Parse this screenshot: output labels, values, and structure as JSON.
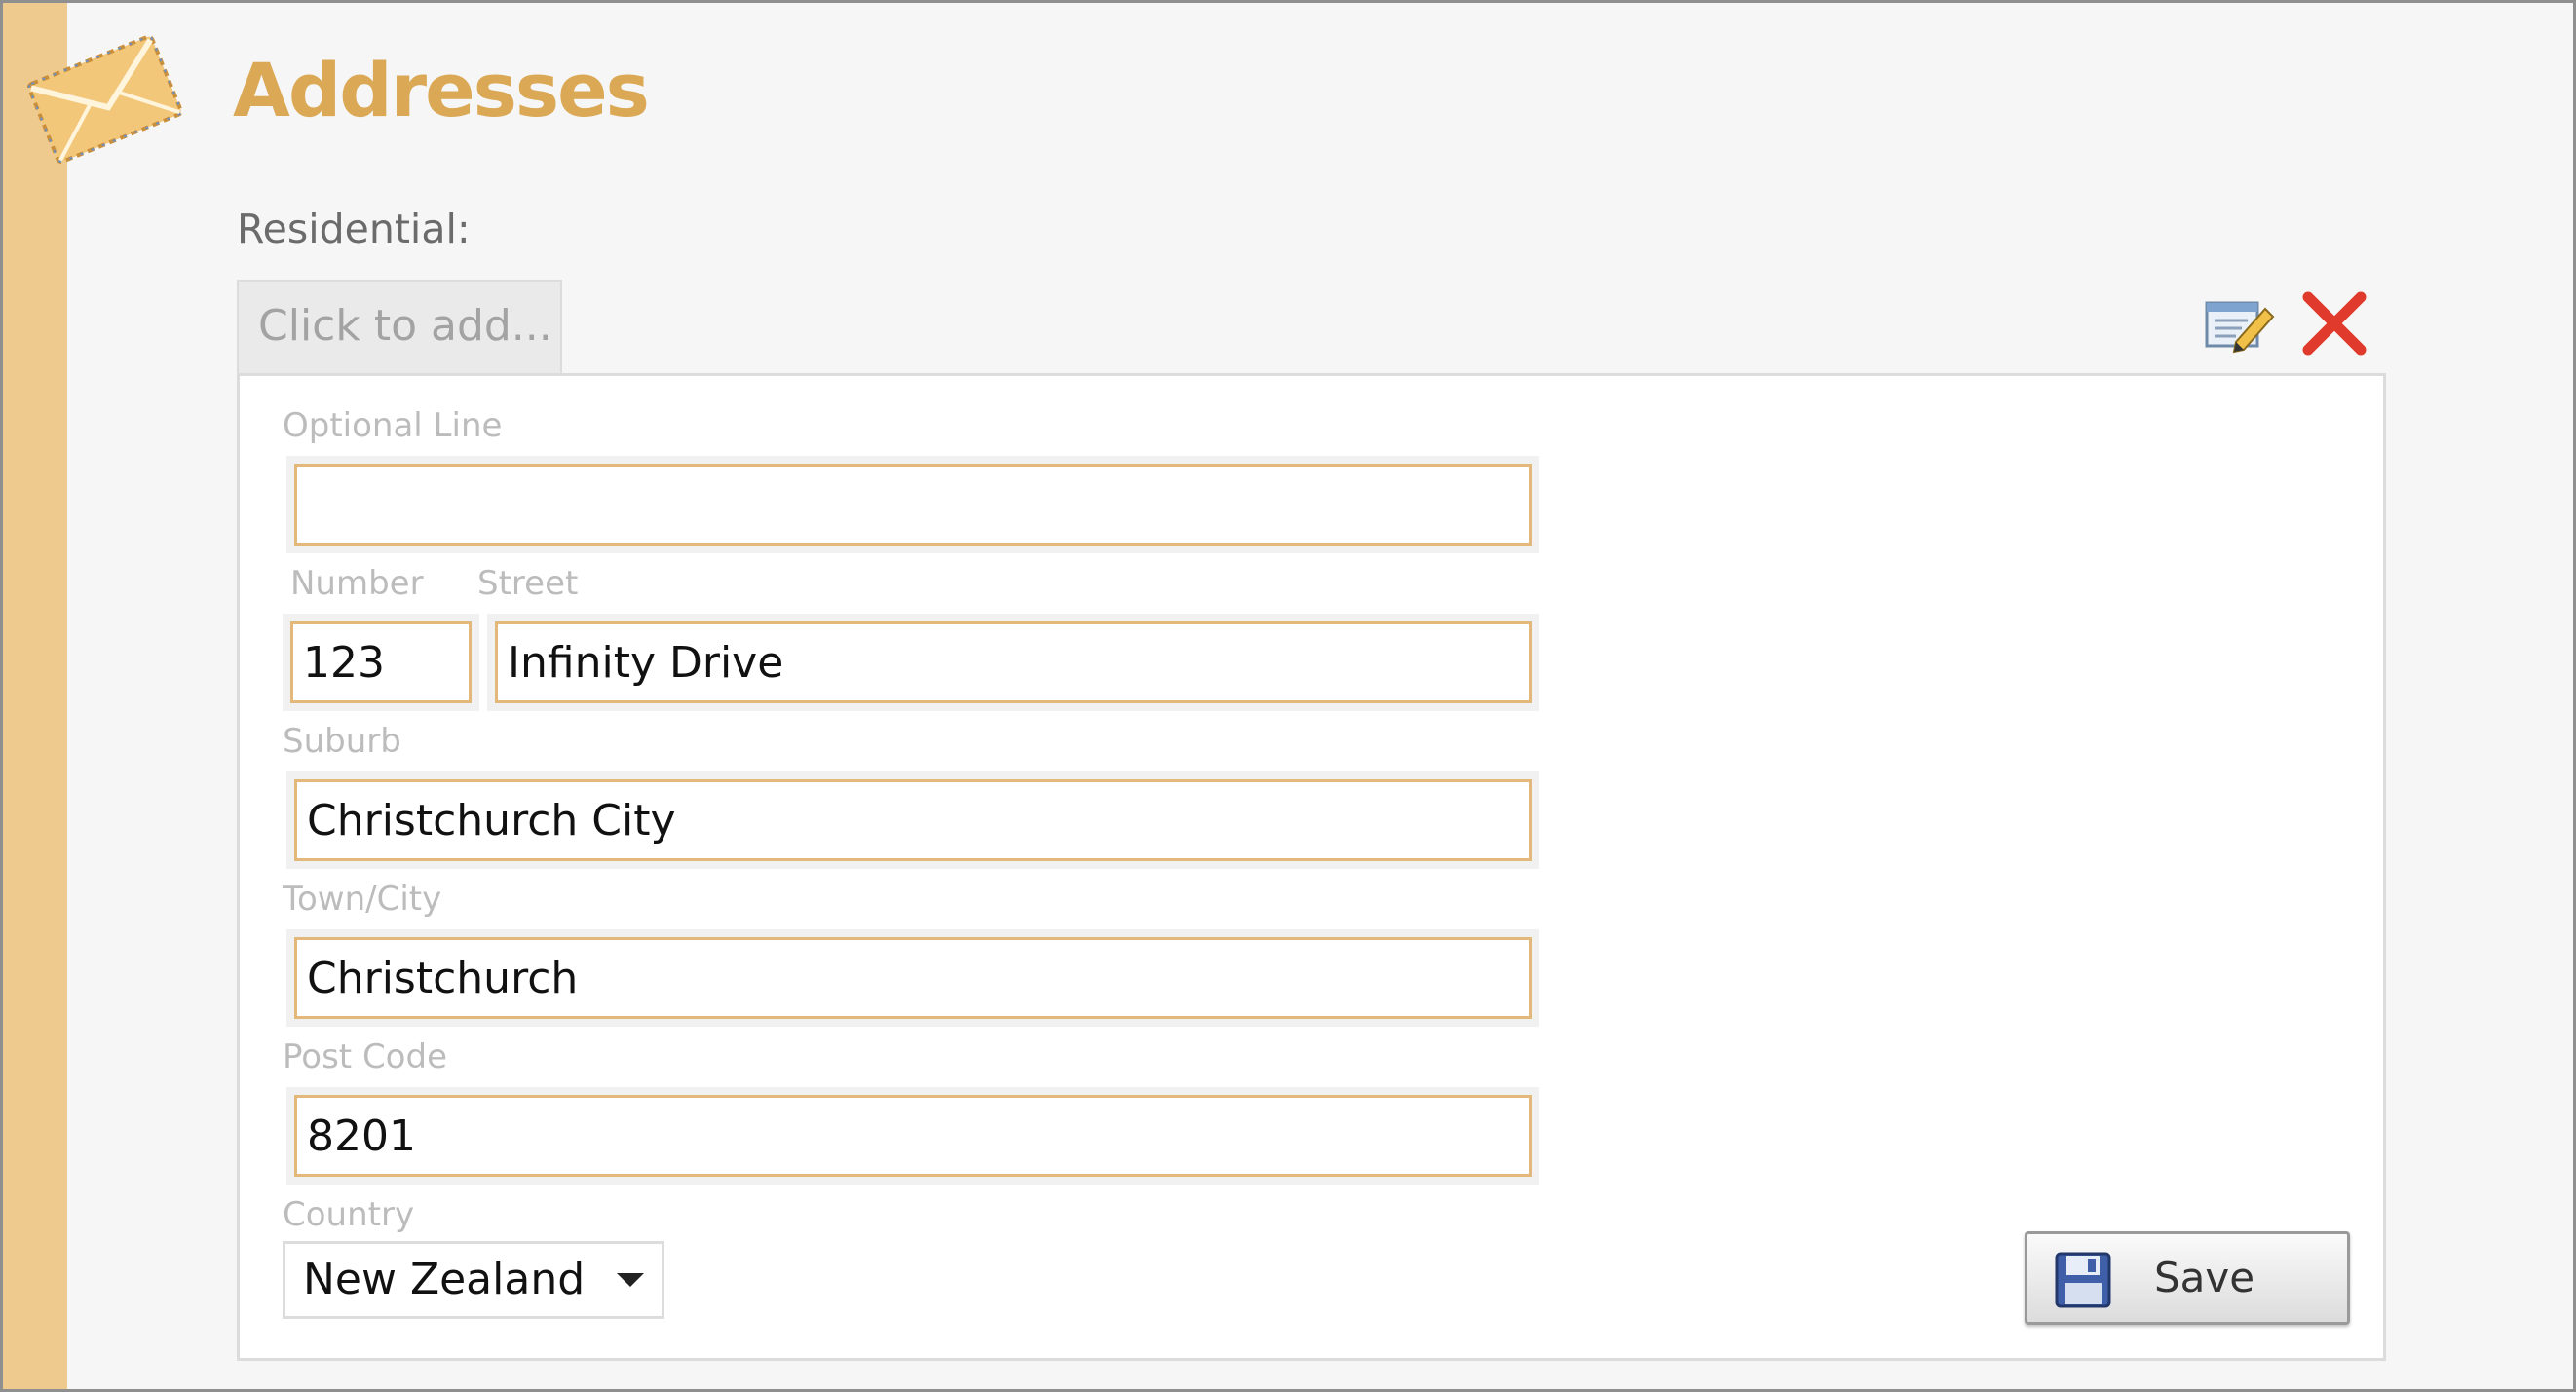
{
  "header": {
    "title": "Addresses",
    "icon": "envelope-icon"
  },
  "colors": {
    "accent": "#dba955",
    "stripe": "#efca8f",
    "field_border": "#e2b97a",
    "delete": "#e03a2c"
  },
  "section": {
    "label": "Residential:",
    "click_to_add": "Click to add..."
  },
  "toolbar": {
    "edit_icon": "edit-icon",
    "delete_icon": "delete-icon"
  },
  "form": {
    "optional_line": {
      "label": "Optional Line",
      "value": ""
    },
    "number": {
      "label": "Number",
      "value": "123"
    },
    "street": {
      "label": "Street",
      "value": "Infinity Drive"
    },
    "suburb": {
      "label": "Suburb",
      "value": "Christchurch City"
    },
    "town_city": {
      "label": "Town/City",
      "value": "Christchurch"
    },
    "post_code": {
      "label": "Post Code",
      "value": "8201"
    },
    "country": {
      "label": "Country",
      "value": "New Zealand"
    },
    "save_label": "Save",
    "save_icon": "floppy-disk-icon"
  }
}
